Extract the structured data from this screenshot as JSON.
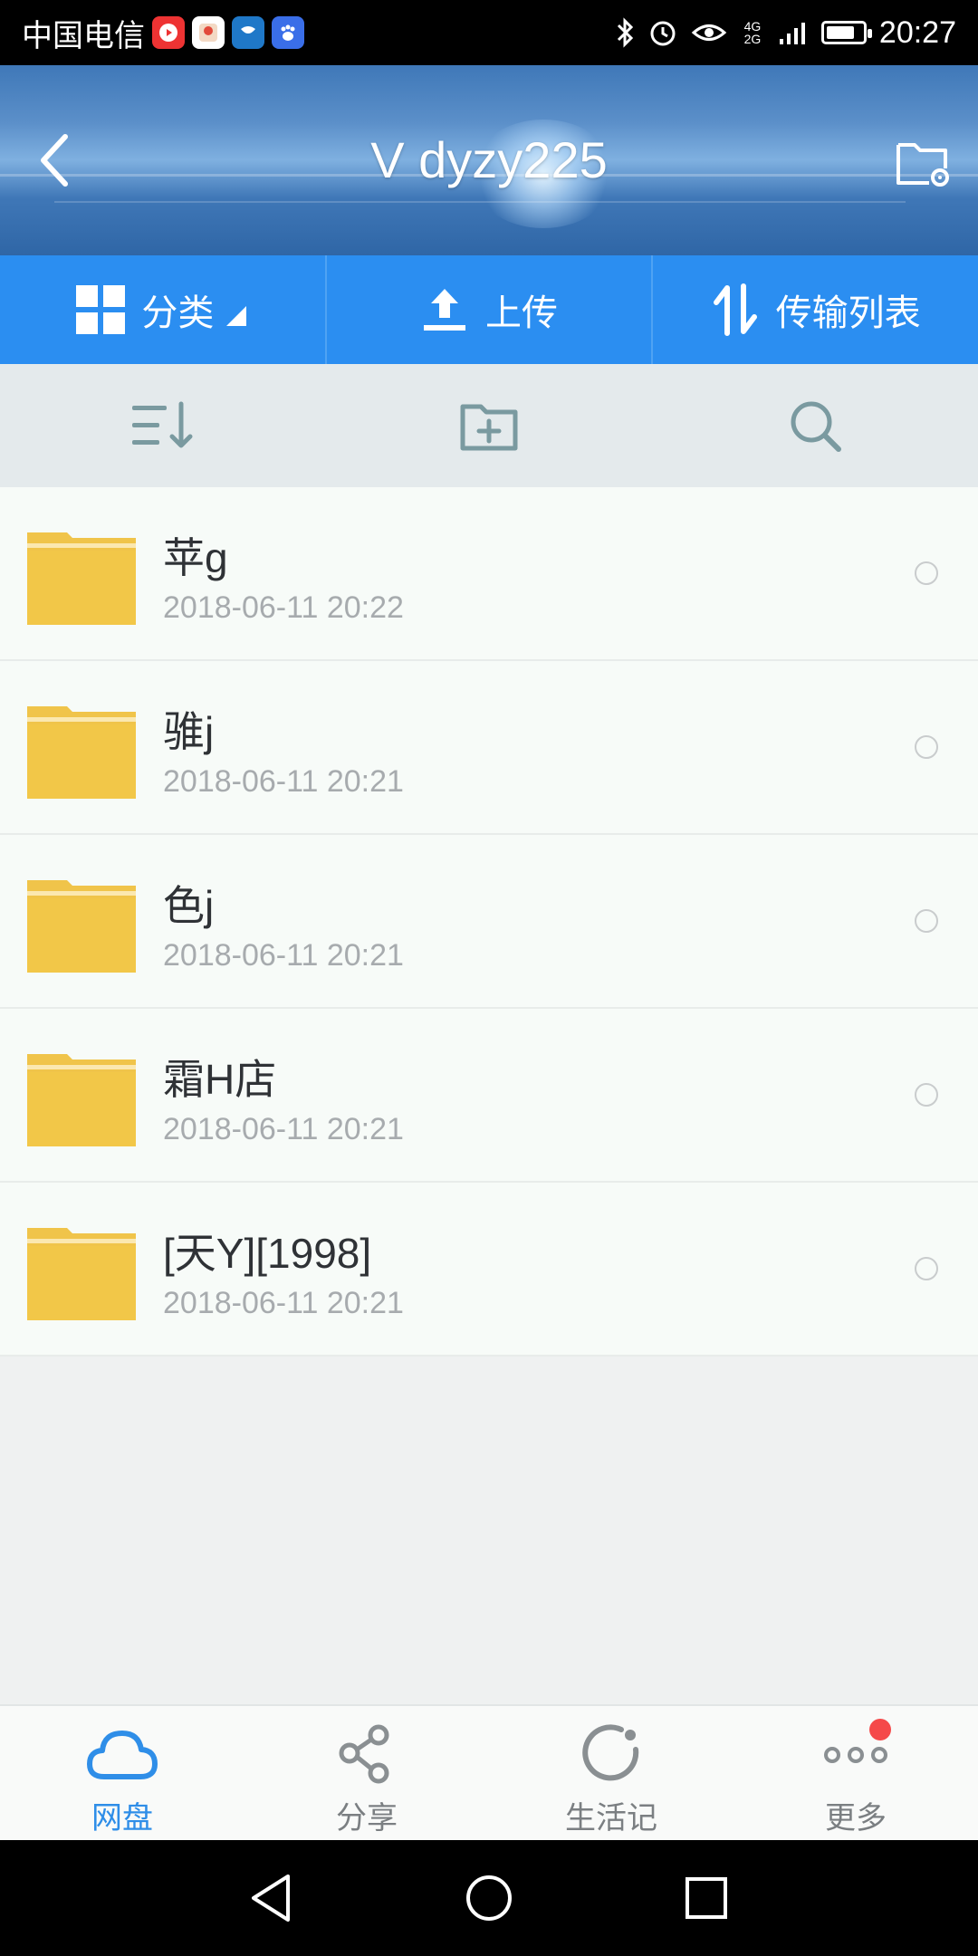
{
  "status_bar": {
    "carrier": "中国电信",
    "time": "20:27",
    "network": "4G 2G",
    "battery_level": 0.8,
    "icons": [
      "video-app-icon",
      "photo-app-icon",
      "chat-app-icon",
      "baidu-app-icon",
      "bluetooth-icon",
      "alarm-icon",
      "eye-comfort-icon",
      "signal-icon",
      "battery-icon"
    ]
  },
  "header": {
    "title": "V dyzy225"
  },
  "actions": [
    {
      "label": "分类",
      "icon": "grid-icon"
    },
    {
      "label": "上传",
      "icon": "upload-icon"
    },
    {
      "label": "传输列表",
      "icon": "transfer-icon"
    }
  ],
  "toolbar": [
    "sort-icon",
    "new-folder-icon",
    "search-icon"
  ],
  "files": [
    {
      "name": "苹g",
      "date": "2018-06-11  20:22"
    },
    {
      "name": "骓j",
      "date": "2018-06-11  20:21"
    },
    {
      "name": "色j",
      "date": "2018-06-11  20:21"
    },
    {
      "name": "霜H店",
      "date": "2018-06-11  20:21"
    },
    {
      "name": "[天Y][1998]",
      "date": "2018-06-11  20:21"
    }
  ],
  "tabs": [
    {
      "label": "网盘",
      "icon": "cloud-icon",
      "active": true
    },
    {
      "label": "分享",
      "icon": "share-icon",
      "active": false
    },
    {
      "label": "生活记",
      "icon": "moment-icon",
      "active": false
    },
    {
      "label": "更多",
      "icon": "more-icon",
      "active": false
    }
  ],
  "colors": {
    "accent": "#2b8ef1",
    "folder": "#f0c44a",
    "badge": "#f5494a"
  }
}
